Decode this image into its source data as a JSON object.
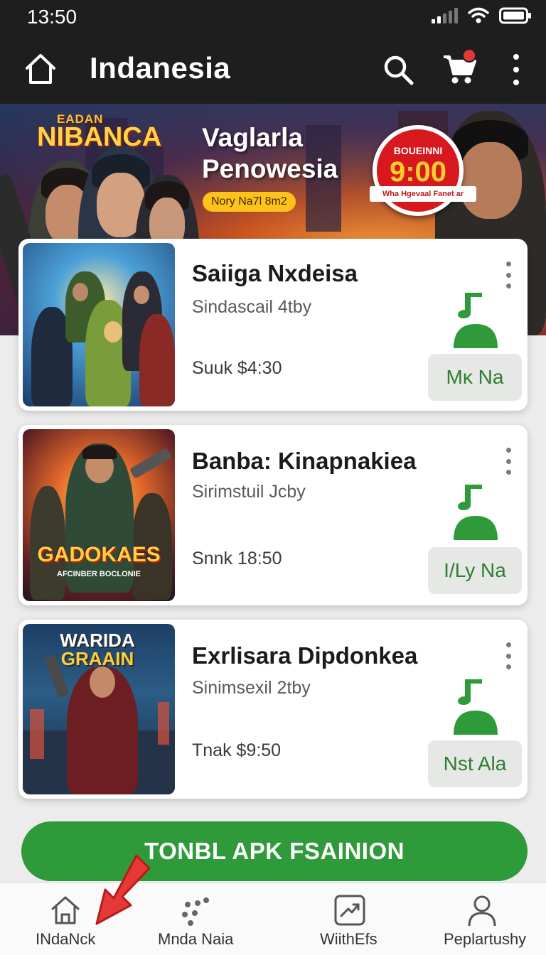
{
  "status_bar": {
    "time": "13:50"
  },
  "app_bar": {
    "title": "Indanesia"
  },
  "banner": {
    "logo_small": "EADAN",
    "logo_big": "NIBANCA",
    "headline_line1": "Vaglarla",
    "headline_line2": "Penowesia",
    "pill": "Nory Na7l 8m2",
    "timer_top": "BOUEINNI",
    "timer_time": "9:00",
    "timer_sub": "Wha Hgevaal Fanet ar"
  },
  "cards": [
    {
      "title": "Saiiga Nxdeisa",
      "subtitle": "Sindascail 4tby",
      "price": "Suuk  $4:30",
      "button": "Mĸ Na"
    },
    {
      "title": "Banba: Kinapnakiea",
      "subtitle": "Sirimstuil Jcby",
      "price": "Snnk  18:50",
      "button": "I/Ly Na",
      "thumb_title": "GADOKAES",
      "thumb_sub": "AFCINBER BOCLONIE"
    },
    {
      "title": "Exrlisara Dipdonkea",
      "subtitle": "Sinimsexil 2tby",
      "price": "Tnak  $9:50",
      "button": "Nst Ala",
      "thumb_title_line1": "WARIDA",
      "thumb_title_line2": "GRAAIN"
    }
  ],
  "cta": {
    "label": "TONBL APK FSAINION"
  },
  "bottom_nav": [
    {
      "label": "INdaNck",
      "icon": "home-icon"
    },
    {
      "label": "Mnda Naia",
      "icon": "dots-icon"
    },
    {
      "label": "WiithEfs",
      "icon": "trending-icon"
    },
    {
      "label": "Peplartushy",
      "icon": "person-icon"
    }
  ],
  "colors": {
    "accent": "#2f9a3a",
    "appbar": "#1e1e1e",
    "badge": "#e53935",
    "arrow": "#e53935"
  }
}
